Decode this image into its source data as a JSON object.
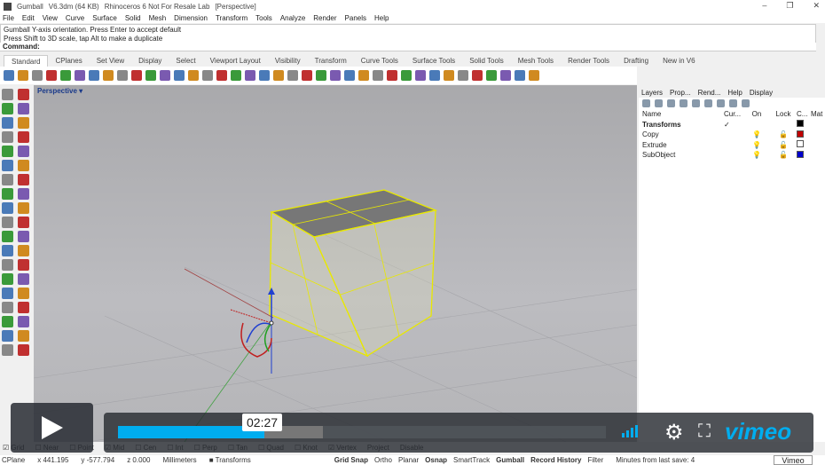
{
  "window": {
    "title_parts": [
      "Gumball",
      "V6.3dm (64 KB)",
      "Rhinoceros 6 Not For Resale Lab",
      "[Perspective]"
    ],
    "controls": [
      "–",
      "❐",
      "✕"
    ]
  },
  "menu": [
    "File",
    "Edit",
    "View",
    "Curve",
    "Surface",
    "Solid",
    "Mesh",
    "Dimension",
    "Transform",
    "Tools",
    "Analyze",
    "Render",
    "Panels",
    "Help"
  ],
  "history": [
    "Gumball Y-axis orientation. Press Enter to accept default",
    "Press Shift to 3D scale, tap Alt to make a duplicate"
  ],
  "command_label": "Command:",
  "tabs": [
    "Standard",
    "CPlanes",
    "Set View",
    "Display",
    "Select",
    "Viewport Layout",
    "Visibility",
    "Transform",
    "Curve Tools",
    "Surface Tools",
    "Solid Tools",
    "Mesh Tools",
    "Render Tools",
    "Drafting",
    "New in V6"
  ],
  "viewport": {
    "label": "Perspective ▾"
  },
  "panel": {
    "tabs": [
      "Layers",
      "Prop...",
      "Rend...",
      "Help",
      "Display"
    ],
    "columns": [
      "Name",
      "Cur...",
      "On",
      "Lock",
      "C...",
      "Mat"
    ],
    "layers": [
      {
        "name": "Transforms",
        "current": "✓",
        "on": "",
        "lock": "",
        "color": "#000000",
        "bold": true
      },
      {
        "name": "Copy",
        "current": "",
        "on": "💡",
        "lock": "🔓",
        "color": "#c00000"
      },
      {
        "name": "Extrude",
        "current": "",
        "on": "💡",
        "lock": "🔓",
        "color": "#ffffff"
      },
      {
        "name": "SubObject",
        "current": "",
        "on": "💡",
        "lock": "🔓",
        "color": "#0000cc"
      }
    ]
  },
  "osnap": [
    "☑ Grid",
    "☐ Near",
    "☐ Point",
    "☑ Mid",
    "☐ Cen",
    "☐ Int",
    "☐ Perp",
    "☐ Tan",
    "☐ Quad",
    "☐ Knot",
    "☑ Vertex",
    "Project",
    "Disable"
  ],
  "status": {
    "cplane": "CPlane",
    "x": "x 441.195",
    "y": "y -577.794",
    "z": "z 0.000",
    "units": "Millimeters",
    "layer": "Transforms",
    "toggles": [
      "Grid Snap",
      "Ortho",
      "Planar",
      "Osnap",
      "SmartTrack",
      "Gumball",
      "Record History",
      "Filter"
    ],
    "save": "Minutes from last save: 4"
  },
  "player": {
    "time": "02:27",
    "played_pct": 30,
    "buffered_pct": 42,
    "brand": "vimeo",
    "vimeo_button": "Vimeo",
    "accent": "#00adef"
  }
}
